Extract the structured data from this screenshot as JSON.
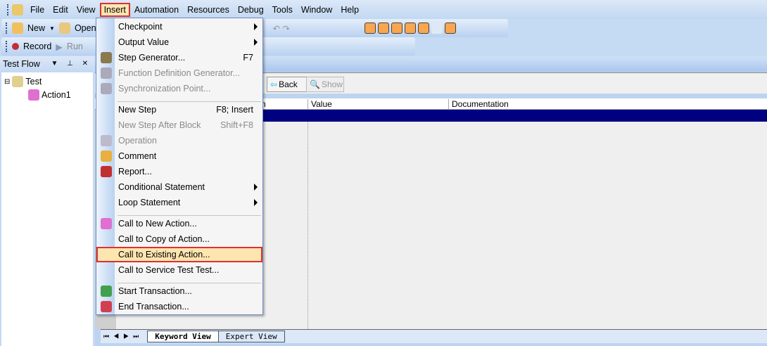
{
  "menubar": [
    "File",
    "Edit",
    "View",
    "Insert",
    "Automation",
    "Resources",
    "Debug",
    "Tools",
    "Window",
    "Help"
  ],
  "toolbar": {
    "new": "New",
    "open": "Open",
    "record": "Record",
    "run": "Run"
  },
  "left_panel": {
    "title": "Test Flow",
    "tree": [
      "Test",
      "Action1"
    ]
  },
  "main": {
    "back": "Back",
    "show": "Show",
    "columns": [
      "n",
      "Value",
      "Documentation"
    ],
    "tabs": [
      "Keyword View",
      "Expert View"
    ]
  },
  "insert_menu": [
    {
      "label": "Checkpoint",
      "sub": true
    },
    {
      "label": "Output Value",
      "sub": true
    },
    {
      "label": "Step Generator...",
      "shortcut": "F7",
      "icon": "step-generator-icon"
    },
    {
      "label": "Function Definition Generator...",
      "disabled": true,
      "icon": "function-generator-icon"
    },
    {
      "label": "Synchronization Point...",
      "disabled": true,
      "icon": "sync-point-icon"
    },
    {
      "sep": true
    },
    {
      "label": "New Step",
      "shortcut": "F8; Insert"
    },
    {
      "label": "New Step After Block",
      "shortcut": "Shift+F8",
      "disabled": true
    },
    {
      "label": "Operation",
      "disabled": true,
      "icon": "operation-icon"
    },
    {
      "label": "Comment",
      "icon": "comment-icon"
    },
    {
      "label": "Report...",
      "icon": "report-icon"
    },
    {
      "label": "Conditional Statement",
      "sub": true
    },
    {
      "label": "Loop Statement",
      "sub": true
    },
    {
      "sep": true
    },
    {
      "label": "Call to New Action...",
      "icon": "new-action-icon"
    },
    {
      "label": "Call to Copy of Action..."
    },
    {
      "label": "Call to Existing Action...",
      "highlight": true
    },
    {
      "label": "Call to Service Test Test..."
    },
    {
      "sep": true
    },
    {
      "label": "Start Transaction...",
      "icon": "start-transaction-icon"
    },
    {
      "label": "End Transaction...",
      "icon": "end-transaction-icon"
    }
  ]
}
